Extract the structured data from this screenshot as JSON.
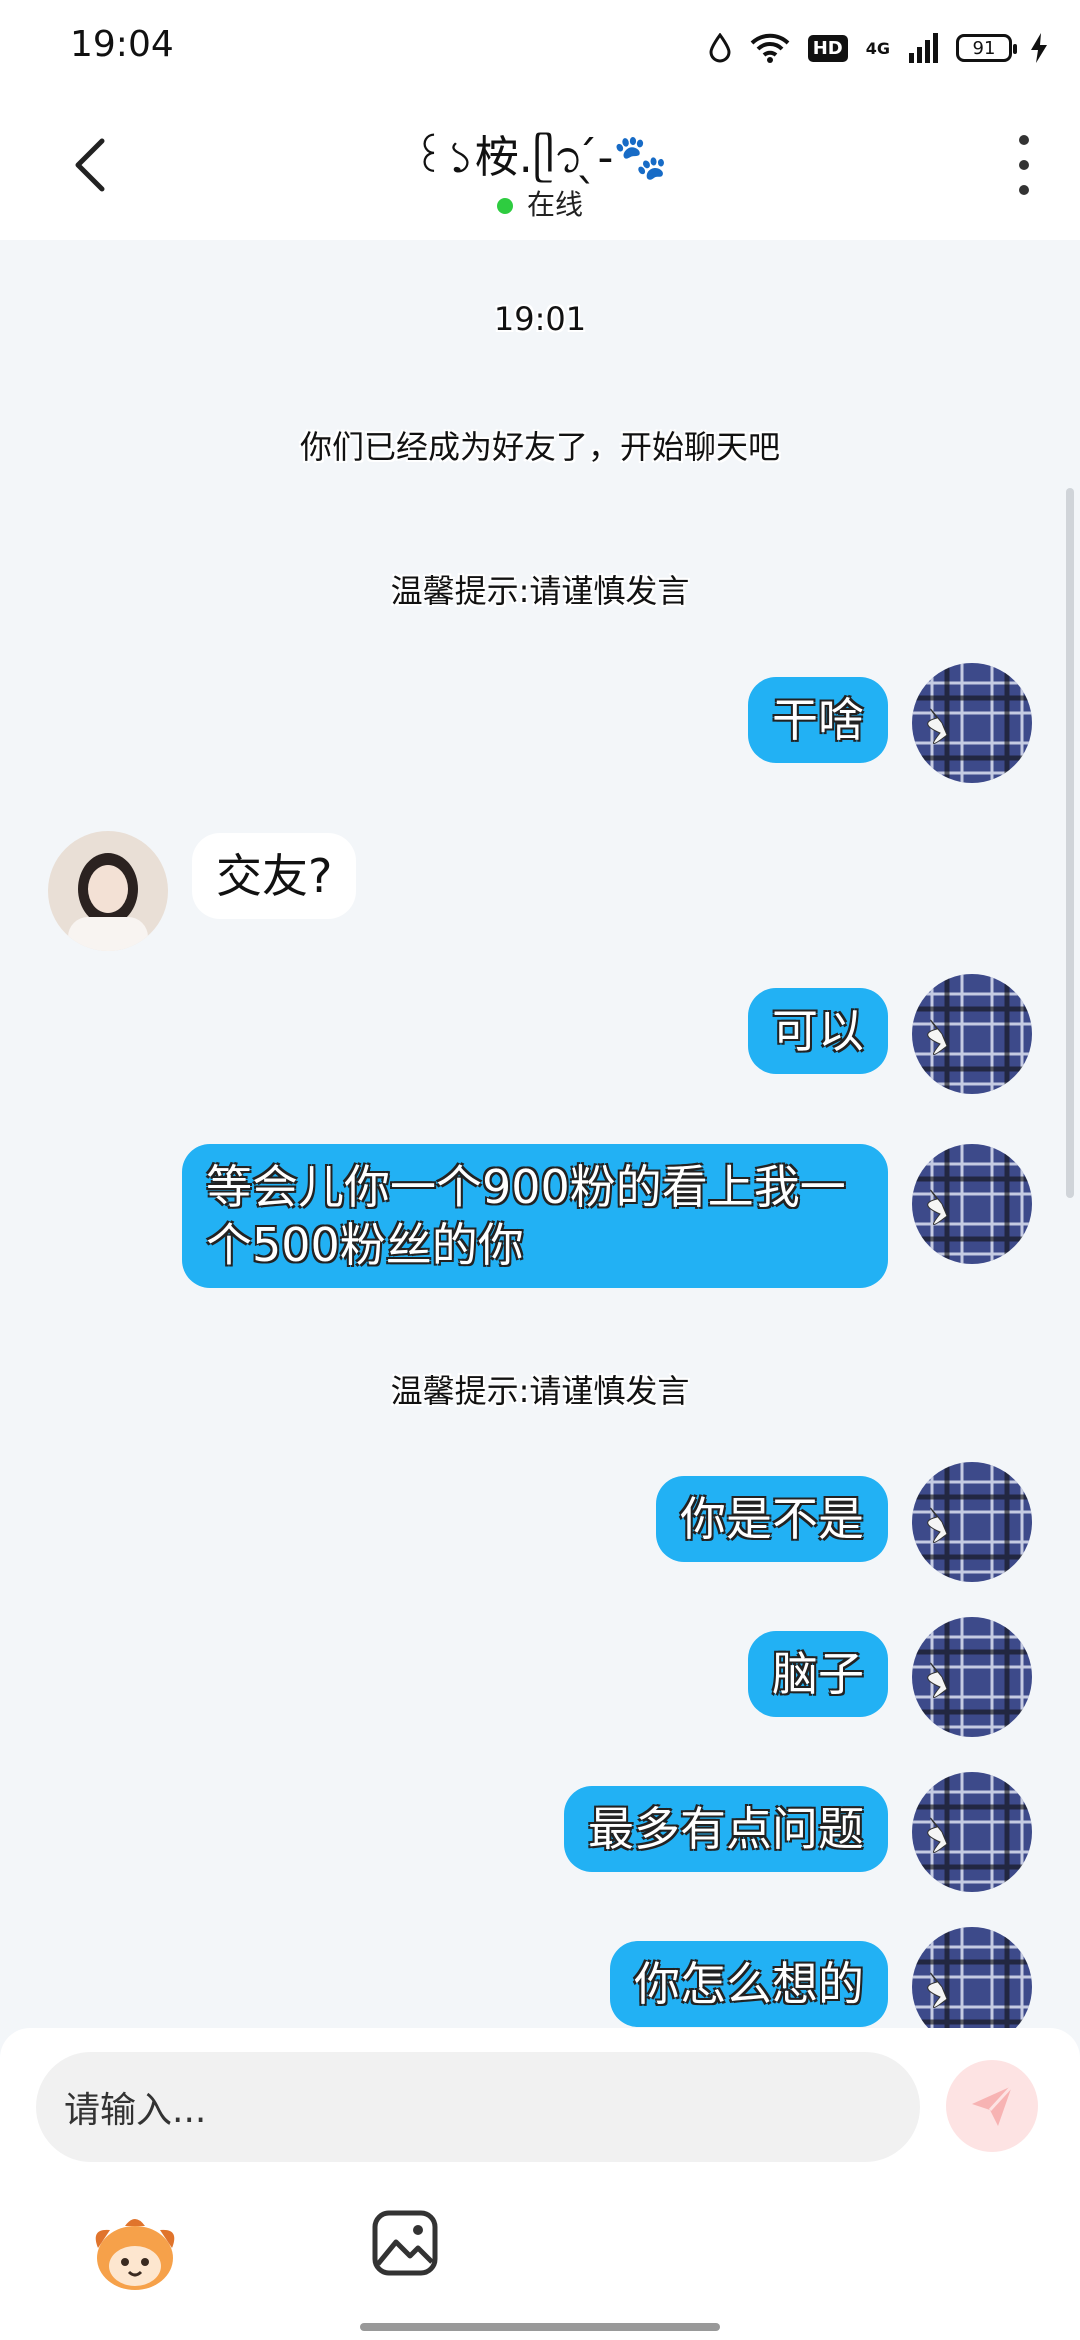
{
  "status_bar": {
    "time": "19:04",
    "network": "4G",
    "hd": "HD",
    "battery": "91"
  },
  "header": {
    "title": "꒰১桉.ᥫ᭡ ̖́-🐾",
    "status": "在线"
  },
  "chat": {
    "timestamp": "19:01",
    "friend_notice": "你们已经成为好友了，开始聊天吧",
    "tip_1": "温馨提示:请谨慎发言",
    "tip_2": "温馨提示:请谨慎发言",
    "messages": [
      {
        "side": "me",
        "text": "干啥"
      },
      {
        "side": "other",
        "text": "交友?"
      },
      {
        "side": "me",
        "text": "可以"
      },
      {
        "side": "me",
        "text": "等会儿你一个900粉的看上我一个500粉丝的你"
      },
      {
        "side": "me",
        "text": "你是不是"
      },
      {
        "side": "me",
        "text": "脑子"
      },
      {
        "side": "me",
        "text": "最多有点问题"
      },
      {
        "side": "me",
        "text": "你怎么想的"
      }
    ]
  },
  "input": {
    "placeholder": "请输入..."
  },
  "colors": {
    "my_bubble": "#22b1f4",
    "background": "#f3f6f9",
    "online_dot": "#2ecc40"
  },
  "icons": [
    "back-arrow-icon",
    "more-icon",
    "send-icon",
    "mascot-icon",
    "image-icon",
    "wifi-icon",
    "signal-icon",
    "water-drop-icon",
    "charging-icon"
  ]
}
